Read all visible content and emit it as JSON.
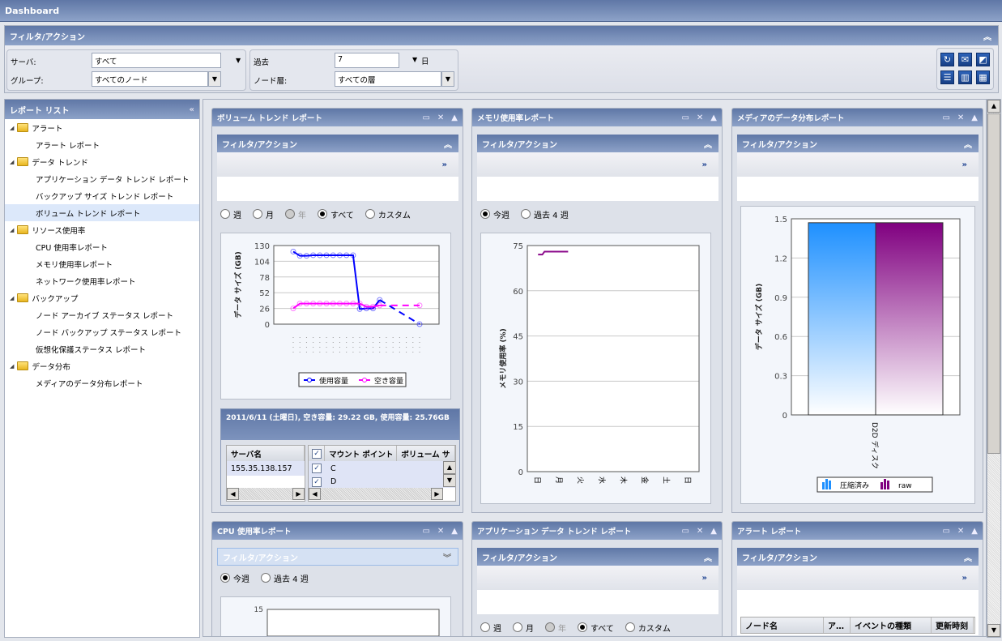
{
  "title": "Dashboard",
  "filters": {
    "header": "フィルタ/アクション",
    "server_label": "サーバ:",
    "server_value": "すべて",
    "group_label": "グループ:",
    "group_value": "すべてのノード",
    "past_label": "過去",
    "past_value": "7",
    "past_unit": "日",
    "tier_label": "ノード層:",
    "tier_value": "すべての層",
    "toolbar_icons": [
      "refresh-icon",
      "email-icon",
      "export-icon",
      "layout-1col-icon",
      "layout-2col-icon",
      "layout-3col-icon"
    ]
  },
  "report_list": {
    "title": "レポート リスト",
    "groups": [
      {
        "label": "アラート",
        "items": [
          "アラート レポート"
        ]
      },
      {
        "label": "データ トレンド",
        "items": [
          "アプリケーション データ トレンド レポート",
          "バックアップ サイズ トレンド レポート",
          "ボリューム トレンド レポート"
        ]
      },
      {
        "label": "リソース使用率",
        "items": [
          "CPU 使用率レポート",
          "メモリ使用率レポート",
          "ネットワーク使用率レポート"
        ]
      },
      {
        "label": "バックアップ",
        "items": [
          "ノード アーカイブ ステータス レポート",
          "ノード バックアップ ステータス レポート",
          "仮想化保護ステータス レポート"
        ]
      },
      {
        "label": "データ分布",
        "items": [
          "メディアのデータ分布レポート"
        ]
      }
    ],
    "selected": "ボリューム トレンド レポート"
  },
  "common": {
    "filter_header": "フィルタ/アクション",
    "expand": "»",
    "period_options": [
      "週",
      "月",
      "年",
      "すべて",
      "カスタム"
    ],
    "week_options": [
      "今週",
      "過去 4 週"
    ]
  },
  "panels": {
    "volume": {
      "title": "ボリューム トレンド レポート",
      "selected_period": "すべて",
      "info_text": "2011/6/11 (土曜日), 空き容量: 29.22 GB, 使用容量: 25.76GB",
      "table_left": {
        "header": "サーバ名",
        "rows": [
          "155.35.138.157"
        ]
      },
      "table_right": {
        "headers": [
          "マウント ポイント",
          "ボリューム サ"
        ],
        "rows": [
          "C",
          "D"
        ]
      }
    },
    "memory": {
      "title": "メモリ使用率レポート",
      "selected": "今週"
    },
    "media": {
      "title": "メディアのデータ分布レポート"
    },
    "cpu": {
      "title": "CPU 使用率レポート",
      "selected": "今週"
    },
    "app_trend": {
      "title": "アプリケーション データ トレンド レポート",
      "selected_period": "すべて"
    },
    "alert": {
      "title": "アラート レポート",
      "columns": [
        "ノード名",
        "ア…",
        "イベントの種類",
        "更新時刻"
      ]
    }
  },
  "chart_data": [
    {
      "id": "volume",
      "type": "line",
      "ylabel": "データ サイズ (GB)",
      "ylim": [
        0,
        130
      ],
      "yticks": [
        0,
        26,
        52,
        78,
        104,
        130
      ],
      "series": [
        {
          "name": "使用容量",
          "color": "#0000ff",
          "x": [
            0,
            1,
            2,
            3,
            4,
            5,
            6,
            7,
            8,
            9,
            10,
            11,
            12,
            13,
            19
          ],
          "values": [
            120,
            113,
            113,
            114,
            114,
            114,
            114,
            114,
            114,
            114,
            25,
            26,
            26,
            40,
            0
          ],
          "dashed_from": 13
        },
        {
          "name": "空き容量",
          "color": "#ff00ff",
          "x": [
            0,
            1,
            2,
            3,
            4,
            5,
            6,
            7,
            8,
            9,
            10,
            11,
            12,
            13,
            19
          ],
          "values": [
            26,
            34,
            34,
            34,
            34,
            34,
            34,
            34,
            34,
            34,
            34,
            29,
            29,
            31,
            31
          ],
          "dashed_from": 13
        }
      ],
      "xcount": 20
    },
    {
      "id": "memory",
      "type": "line",
      "ylabel": "メモリ使用率 (%)",
      "ylim": [
        0,
        75
      ],
      "yticks": [
        0,
        15,
        30,
        45,
        60,
        75
      ],
      "categories": [
        "日",
        "月",
        "火",
        "水",
        "木",
        "金",
        "土",
        "日"
      ],
      "series": [
        {
          "name": "メモリ",
          "color": "#8b0a8b",
          "x": [
            0,
            0.2,
            0.3,
            1.4
          ],
          "values": [
            72,
            72,
            73,
            73
          ]
        }
      ]
    },
    {
      "id": "media",
      "type": "bar",
      "ylabel": "データ サイズ (GB)",
      "ylim": [
        0,
        1.5
      ],
      "yticks": [
        0,
        0.3,
        0.6,
        0.9,
        1.2,
        1.5
      ],
      "categories": [
        "D2D ディスク"
      ],
      "series": [
        {
          "name": "圧縮済み",
          "color": "#1e90ff",
          "values": [
            1.47
          ]
        },
        {
          "name": "raw",
          "color": "#800080",
          "values": [
            1.47
          ]
        }
      ]
    },
    {
      "id": "cpu",
      "type": "line",
      "yticks_visible": [
        15
      ]
    }
  ]
}
